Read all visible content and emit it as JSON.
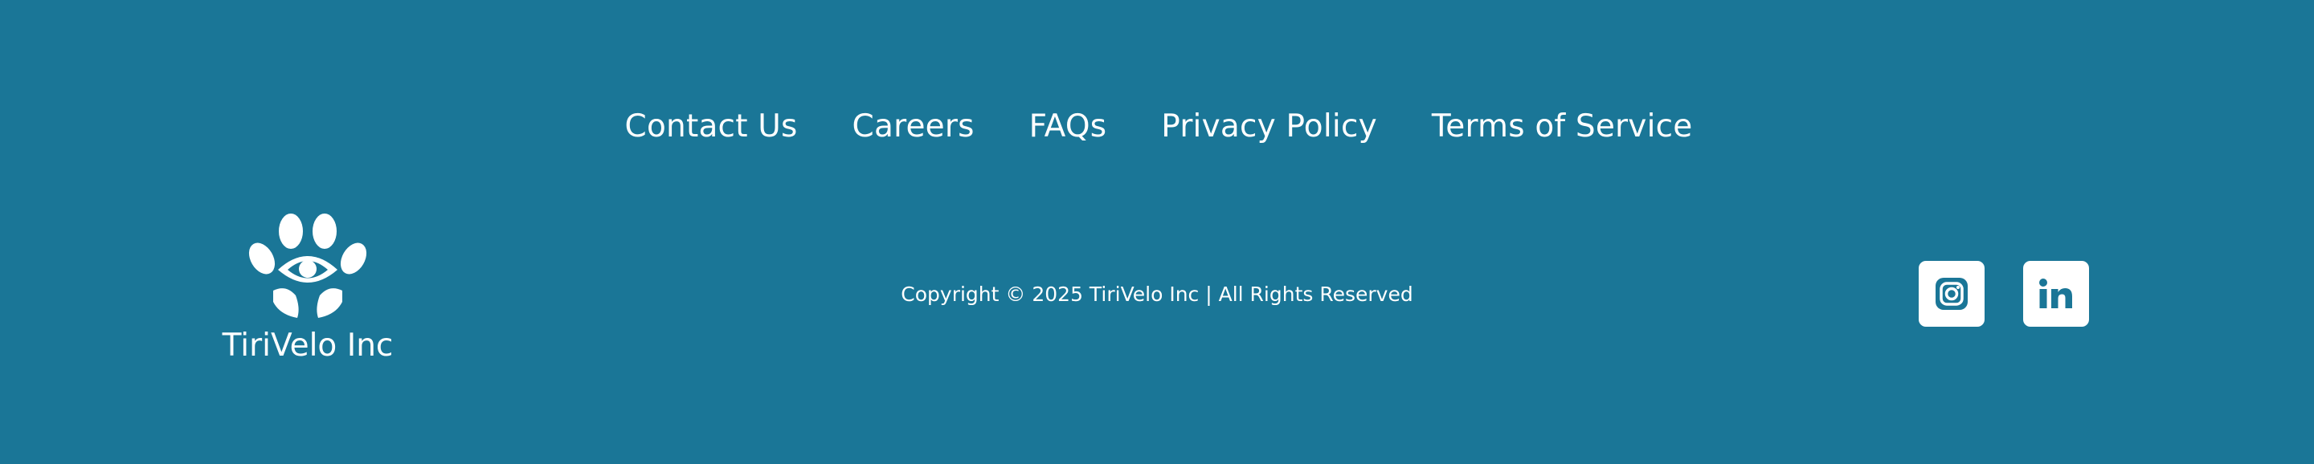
{
  "footer": {
    "nav": [
      {
        "label": "Contact Us"
      },
      {
        "label": "Careers"
      },
      {
        "label": "FAQs"
      },
      {
        "label": "Privacy Policy"
      },
      {
        "label": "Terms of Service"
      }
    ],
    "brand_name": "TiriVelo Inc",
    "copyright": "Copyright © 2025 TiriVelo Inc | All Rights Reserved",
    "social": [
      {
        "icon": "instagram-icon"
      },
      {
        "icon": "linkedin-icon"
      }
    ]
  },
  "colors": {
    "background": "#1a7697",
    "foreground": "#ffffff"
  }
}
